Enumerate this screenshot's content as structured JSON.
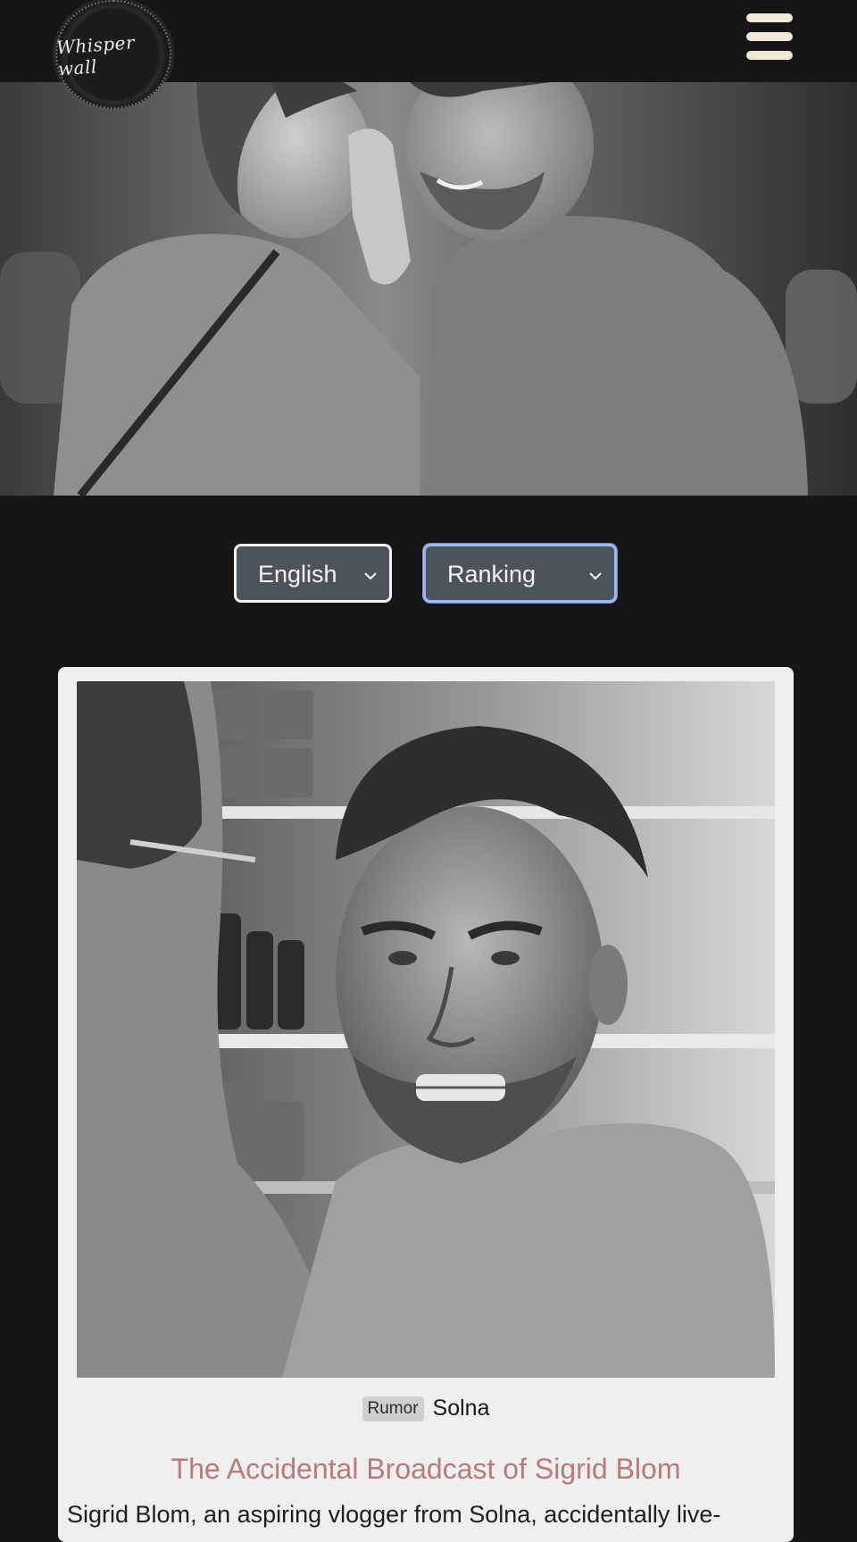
{
  "header": {
    "logo_text": "Whisper wall",
    "menu_icon": "hamburger-icon"
  },
  "hero": {
    "image": "hero-photo"
  },
  "filters": {
    "language": {
      "selected": "English"
    },
    "sort": {
      "selected": "Ranking"
    }
  },
  "story": {
    "image": "story-photo",
    "badge": "Rumor",
    "location": "Solna",
    "title": "The Accidental Broadcast of Sigrid Blom",
    "excerpt": "Sigrid Blom, an aspiring vlogger from Solna, accidentally live-"
  },
  "colors": {
    "background": "#161616",
    "menu_bars": "#f2e8d6",
    "title_accent": "#b77b7b",
    "select_bg": "#4d535b",
    "focus_outline": "#9cb8f0"
  }
}
